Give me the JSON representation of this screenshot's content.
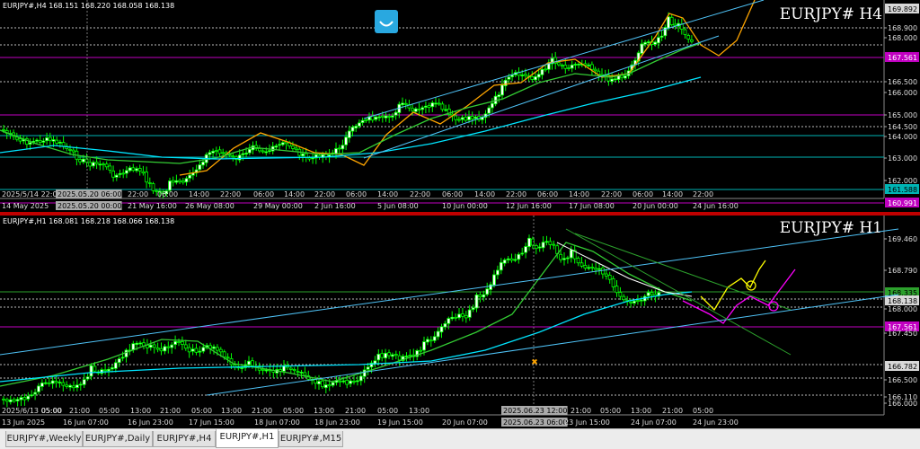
{
  "h4": {
    "info": "EURJPY#,H4  168.151 168.220 168.058 168.138",
    "title": "EURJPY# H4",
    "price_labels": [
      {
        "text": "169.892",
        "bg": "#d8d8d8",
        "fg": "#000"
      },
      {
        "text": "168.900",
        "bg": "",
        "fg": "#ddd"
      },
      {
        "text": "168.000",
        "bg": "",
        "fg": "#ddd"
      },
      {
        "text": "167.561",
        "bg": "#c000c0",
        "fg": "#fff"
      },
      {
        "text": "166.500",
        "bg": "",
        "fg": "#ddd"
      },
      {
        "text": "166.000",
        "bg": "",
        "fg": "#ddd"
      },
      {
        "text": "165.000",
        "bg": "",
        "fg": "#ddd"
      },
      {
        "text": "164.500",
        "bg": "",
        "fg": "#ddd"
      },
      {
        "text": "164.000",
        "bg": "",
        "fg": "#ddd"
      },
      {
        "text": "163.000",
        "bg": "",
        "fg": "#ddd"
      },
      {
        "text": "162.000",
        "bg": "",
        "fg": "#ddd"
      },
      {
        "text": "161.588",
        "bg": "#00b4b4",
        "fg": "#000"
      },
      {
        "text": "160.991",
        "bg": "#c000c0",
        "fg": "#fff"
      }
    ],
    "time_labels_top": [
      "2025/5/14 22:00",
      "2025.05.20 06:00",
      "22:00",
      "06:00",
      "14:00",
      "22:00",
      "06:00",
      "14:00",
      "22:00",
      "06:00",
      "14:00",
      "22:00",
      "06:00",
      "14:00",
      "22:00",
      "06:00",
      "14:00",
      "22:00",
      "06:00",
      "14:00",
      "22:00"
    ],
    "time_labels_bottom": [
      "14 May 2025",
      "2025.05.20 00:00",
      "21 May 16:00",
      "26 May 08:00",
      "29 May 00:00",
      "2 Jun 16:00",
      "5 Jun 08:00",
      "10 Jun 00:00",
      "12 Jun 16:00",
      "17 Jun 08:00",
      "20 Jun 00:00",
      "24 Jun 16:00"
    ]
  },
  "h1": {
    "info": "EURJPY#,H1  168.081 168.218 168.066 168.138",
    "title": "EURJPY# H1",
    "price_labels": [
      {
        "text": "169.460",
        "bg": "",
        "fg": "#ddd"
      },
      {
        "text": "168.790",
        "bg": "",
        "fg": "#ddd"
      },
      {
        "text": "168.335",
        "bg": "#2ca02c",
        "fg": "#000"
      },
      {
        "text": "168.138",
        "bg": "#d8d8d8",
        "fg": "#000"
      },
      {
        "text": "168.000",
        "bg": "",
        "fg": "#ddd"
      },
      {
        "text": "167.561",
        "bg": "#c000c0",
        "fg": "#fff"
      },
      {
        "text": "167.450",
        "bg": "",
        "fg": "#ddd"
      },
      {
        "text": "166.782",
        "bg": "#d8d8d8",
        "fg": "#000"
      },
      {
        "text": "166.500",
        "bg": "",
        "fg": "#ddd"
      },
      {
        "text": "166.110",
        "bg": "",
        "fg": "#ddd"
      },
      {
        "text": "166.000",
        "bg": "",
        "fg": "#ddd"
      }
    ],
    "time_labels_top": [
      "2025/6/13 05:00",
      "05:00",
      "21:00",
      "05:00",
      "13:00",
      "21:00",
      "05:00",
      "13:00",
      "21:00",
      "05:00",
      "13:00",
      "21:00",
      "05:00",
      "13:00",
      "2025.06.23 12:00",
      "21:00",
      "05:00",
      "13:00",
      "21:00",
      "05:00"
    ],
    "time_labels_bottom": [
      "13 Jun 2025",
      "16 Jun 07:00",
      "16 Jun 23:00",
      "17 Jun 15:00",
      "18 Jun 07:00",
      "18 Jun 23:00",
      "19 Jun 15:00",
      "20 Jun 07:00",
      "2025.06.23 06:00",
      "23 Jun 15:00",
      "24 Jun 07:00",
      "24 Jun 23:00"
    ]
  },
  "tabs": [
    {
      "label": "EURJPY#,Weekly",
      "active": false
    },
    {
      "label": "EURJPY#,Daily",
      "active": false
    },
    {
      "label": "EURJPY#,H4",
      "active": false
    },
    {
      "label": "EURJPY#,H1",
      "active": true
    },
    {
      "label": "EURJPY#,M15",
      "active": false
    }
  ],
  "colors": {
    "bg": "#000000",
    "candle": "#00ff00",
    "ma_fast": "#ffa500",
    "ma_mid": "#33cc33",
    "ma_slow": "#00e5ff",
    "channel": "#4fc3f7",
    "magenta": "#ff00ff",
    "forecast_yellow": "#ffff00"
  },
  "icons": {
    "robot": "smiley-face-icon"
  }
}
